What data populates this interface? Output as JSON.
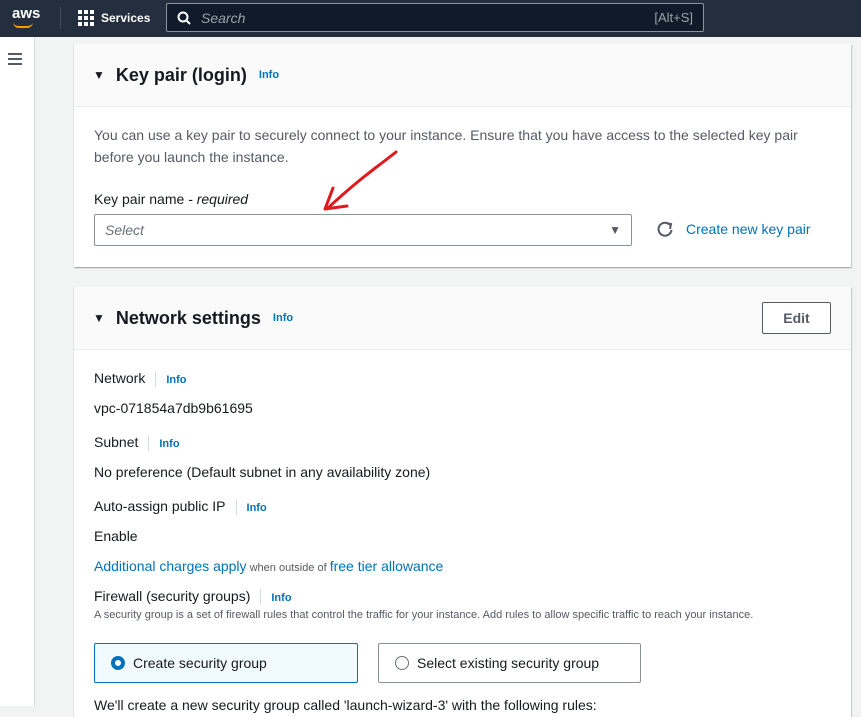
{
  "topbar": {
    "logo": "aws",
    "services": "Services",
    "search_placeholder": "Search",
    "shortcut": "[Alt+S]"
  },
  "keypair": {
    "title": "Key pair (login)",
    "info": "Info",
    "description": "You can use a key pair to securely connect to your instance. Ensure that you have access to the selected key pair before you launch the instance.",
    "field_label": "Key pair name",
    "required": " - required",
    "select_placeholder": "Select",
    "create_link": "Create new key pair"
  },
  "network": {
    "title": "Network settings",
    "info": "Info",
    "edit": "Edit",
    "network_label": "Network",
    "network_value": "vpc-071854a7db9b61695",
    "subnet_label": "Subnet",
    "subnet_value": "No preference (Default subnet in any availability zone)",
    "public_ip_label": "Auto-assign public IP",
    "public_ip_value": "Enable",
    "charges_link": "Additional charges apply",
    "charges_mid": " when outside of ",
    "free_tier_link": "free tier allowance",
    "firewall_label": "Firewall (security groups)",
    "firewall_desc": "A security group is a set of firewall rules that control the traffic for your instance. Add rules to allow specific traffic to reach your instance.",
    "radio_create": "Create security group",
    "radio_existing": "Select existing security group",
    "footer_text": "We'll create a new security group called 'launch-wizard-3' with the following rules:"
  },
  "colors": {
    "accent": "#0073bb",
    "topbar": "#232f3e",
    "annotation": "#e0191f"
  }
}
